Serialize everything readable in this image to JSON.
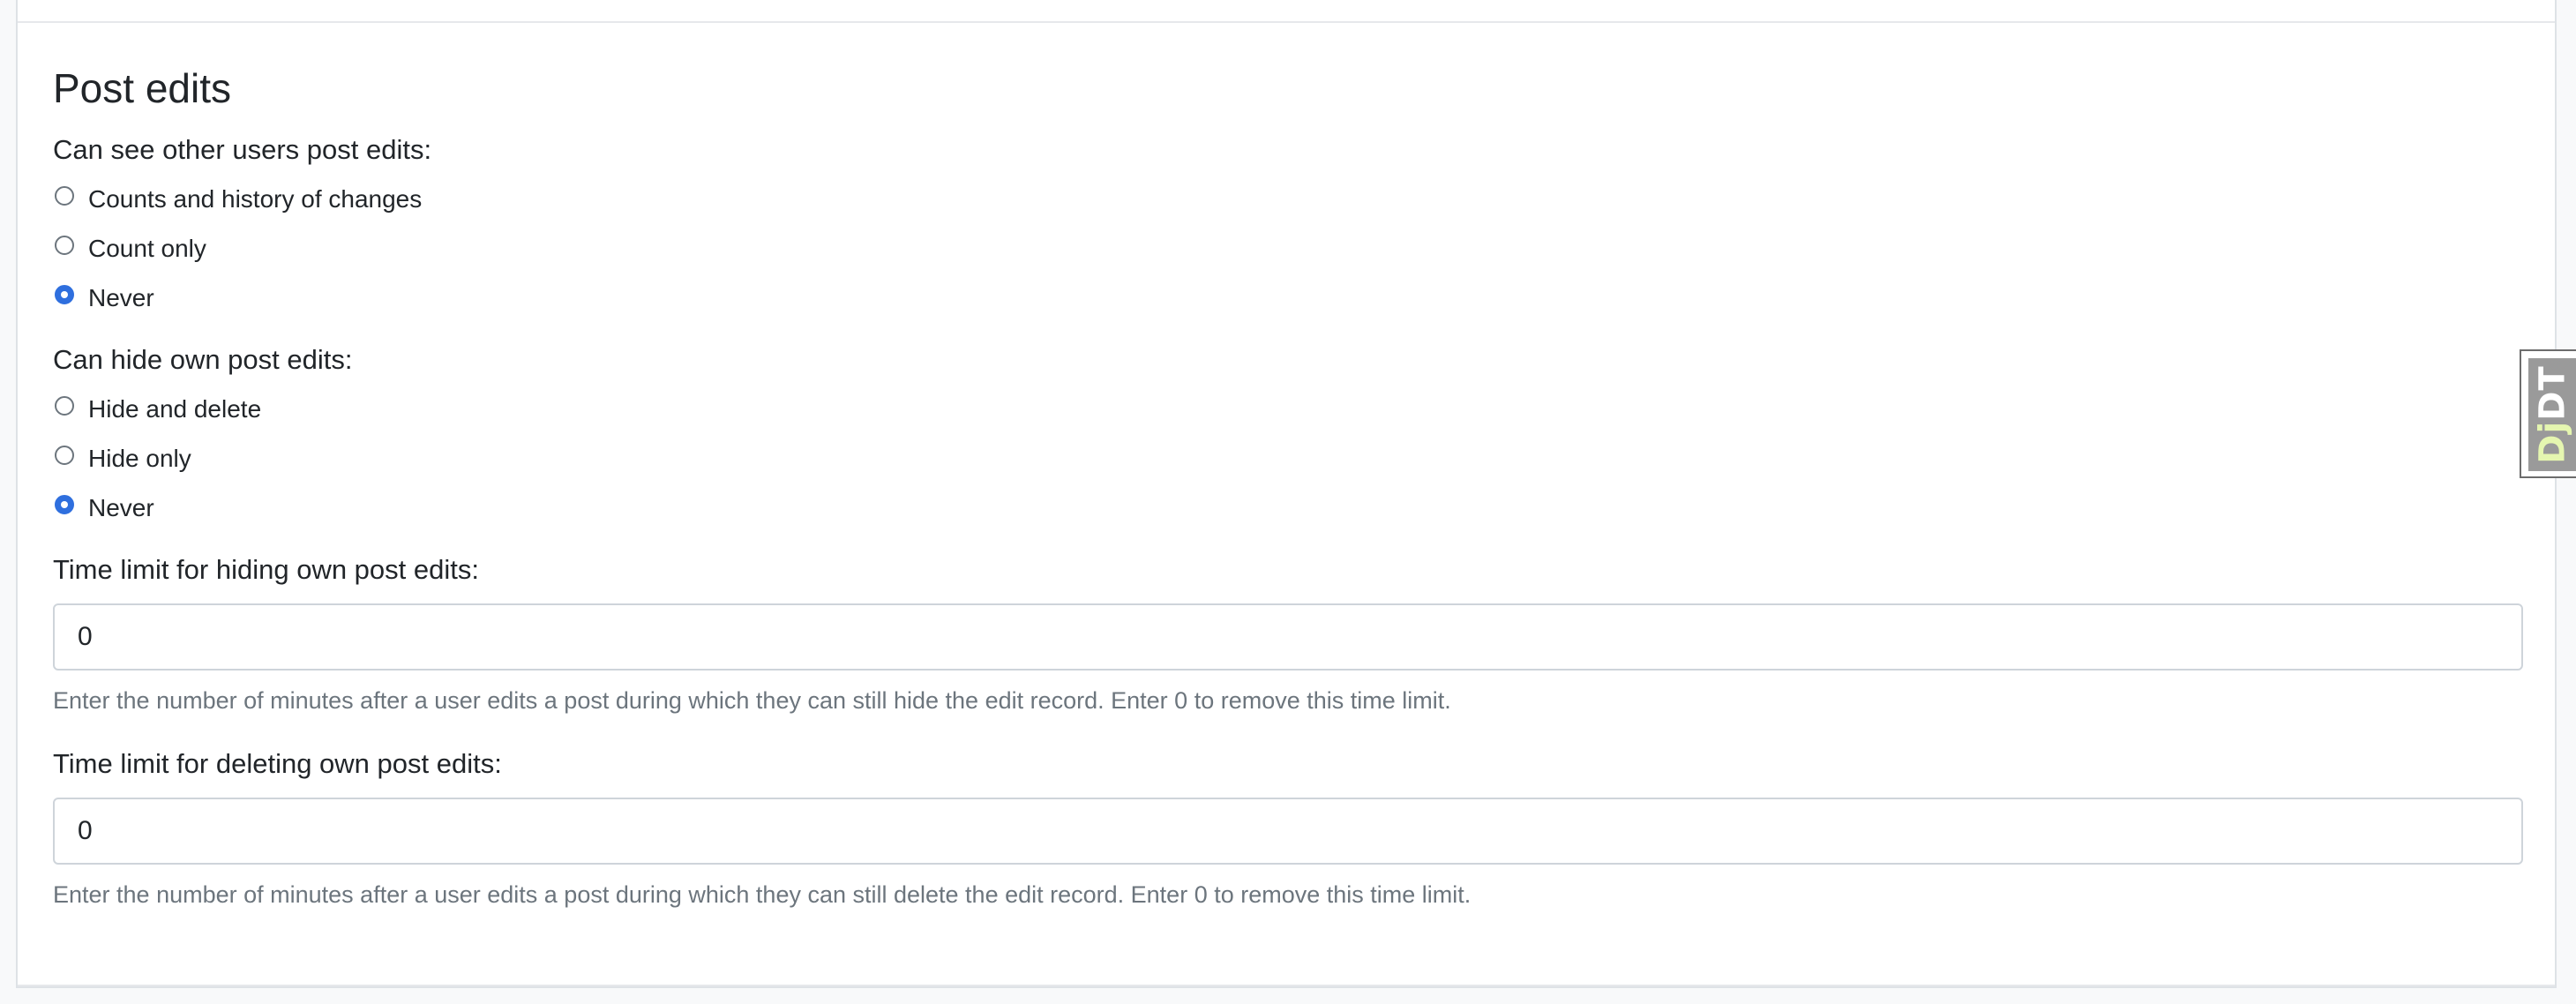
{
  "section": {
    "title": "Post edits"
  },
  "see_edits": {
    "label": "Can see other users post edits:",
    "options": [
      {
        "label": "Counts and history of changes",
        "checked": false
      },
      {
        "label": "Count only",
        "checked": false
      },
      {
        "label": "Never",
        "checked": true
      }
    ]
  },
  "hide_edits": {
    "label": "Can hide own post edits:",
    "options": [
      {
        "label": "Hide and delete",
        "checked": false
      },
      {
        "label": "Hide only",
        "checked": false
      },
      {
        "label": "Never",
        "checked": true
      }
    ]
  },
  "hide_time_limit": {
    "label": "Time limit for hiding own post edits:",
    "value": "0",
    "help": "Enter the number of minutes after a user edits a post during which they can still hide the edit record. Enter 0 to remove this time limit."
  },
  "delete_time_limit": {
    "label": "Time limit for deleting own post edits:",
    "value": "0",
    "help": "Enter the number of minutes after a user edits a post during which they can still delete the edit record. Enter 0 to remove this time limit."
  },
  "debug_toolbar": {
    "handle_prefix": "Dj",
    "handle_suffix": "DT"
  },
  "colors": {
    "accent": "#2f6fde",
    "muted_text": "#6c757d",
    "border": "#ced4da"
  }
}
